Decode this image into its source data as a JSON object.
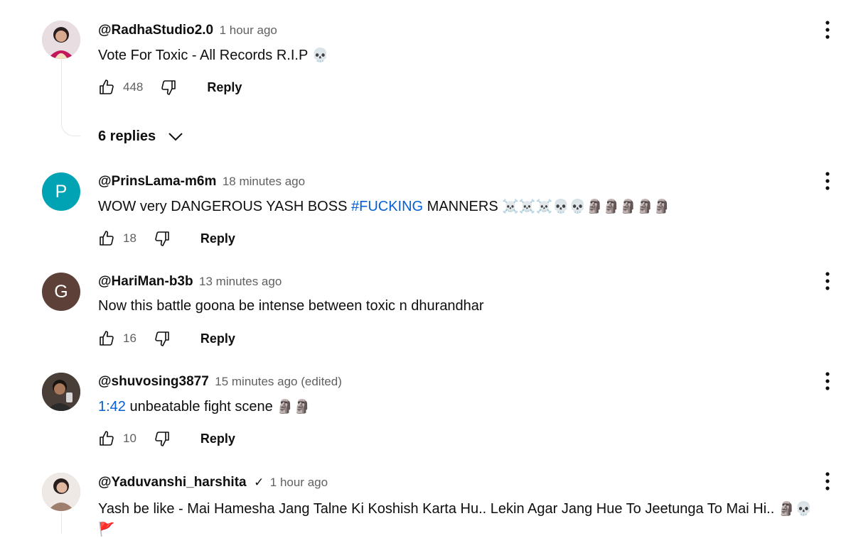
{
  "comments": [
    {
      "author": "@RadhaStudio2.0",
      "time": "1 hour ago",
      "text": "Vote For Toxic - All Records R.I.P ",
      "emoji": "💀",
      "likes": "448",
      "reply_label": "Reply",
      "replies_label": "6 replies",
      "avatar_color": "#c9a7b3"
    },
    {
      "author": "@PrinsLama-m6m",
      "time": "18 minutes ago",
      "text_before": "WOW very DANGEROUS  YASH BOSS ",
      "hashtag": "#FUCKING",
      "text_after": " MANNERS ",
      "emoji": "☠️☠️☠️💀💀🗿🗿🗿🗿🗿",
      "likes": "18",
      "reply_label": "Reply",
      "avatar_letter": "P",
      "avatar_color": "#00a3b4"
    },
    {
      "author": "@HariMan-b3b",
      "time": "13 minutes ago",
      "text": "Now this battle goona be intense between toxic n dhurandhar",
      "likes": "16",
      "reply_label": "Reply",
      "avatar_letter": "G",
      "avatar_color": "#5d4037"
    },
    {
      "author": "@shuvosing3877",
      "time": "15 minutes ago (edited)",
      "timestamp_link": "1:42",
      "text": " unbeatable fight scene ",
      "emoji": "🗿🗿",
      "likes": "10",
      "reply_label": "Reply",
      "avatar_color": "#3b3b3b"
    },
    {
      "author": "@Yaduvanshi_harshita",
      "verified": "✓",
      "time": "1 hour ago",
      "text": "Yash be like - Mai Hamesha Jang Talne Ki Koshish Karta Hu.. Lekin Agar Jang Hue To Jeetunga To Mai Hi.. ",
      "emoji": "🗿💀",
      "flag": "🚩",
      "avatar_color": "#b8a49a"
    }
  ]
}
